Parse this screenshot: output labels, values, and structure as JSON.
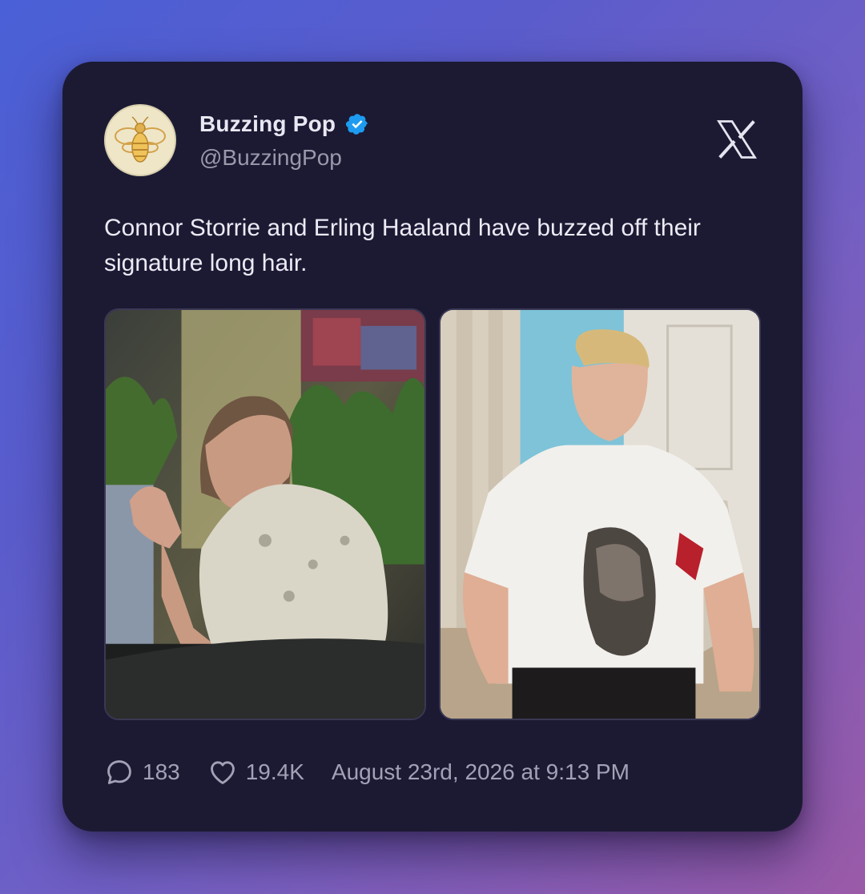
{
  "author": {
    "display_name": "Buzzing Pop",
    "handle": "@BuzzingPop",
    "verified": true,
    "avatar_icon": "bee-icon"
  },
  "platform_icon": "x-logo-icon",
  "tweet": {
    "text": "Connor Storrie and Erling Haaland have buzzed off their signature long hair."
  },
  "media": [
    {
      "icon": "photo-restaurant-man"
    },
    {
      "icon": "photo-man-white-tshirt"
    }
  ],
  "footer": {
    "replies": "183",
    "likes": "19.4K",
    "timestamp": "August 23rd, 2026 at 9:13 PM"
  },
  "colors": {
    "card_bg": "#1c1a33",
    "verified_blue": "#1d9bf0",
    "text_primary": "#e9e7f2",
    "text_secondary": "#9a98ab"
  }
}
